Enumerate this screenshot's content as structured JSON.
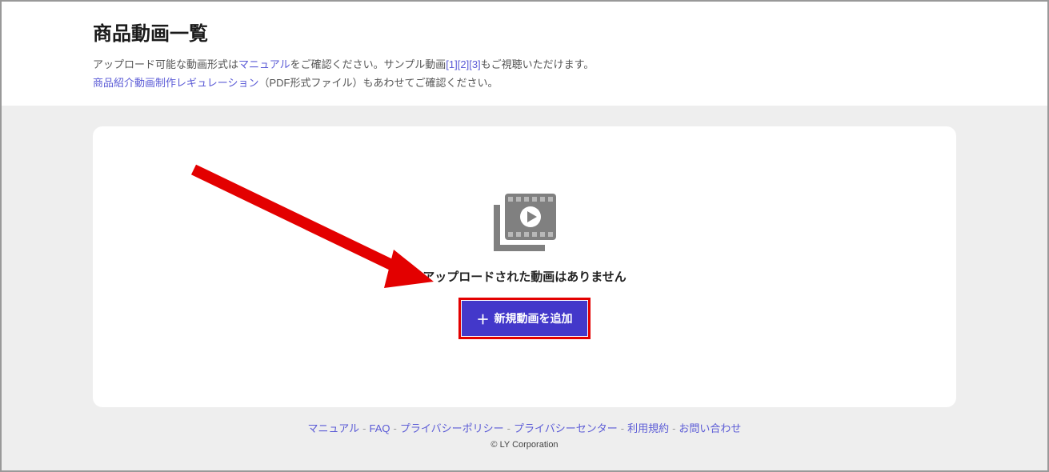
{
  "header": {
    "title": "商品動画一覧",
    "desc_line1_pre": "アップロード可能な動画形式は",
    "desc_line1_manual": "マニュアル",
    "desc_line1_mid": "をご確認ください。サンプル動画",
    "sample1": "[1]",
    "sample2": "[2]",
    "sample3": "[3]",
    "desc_line1_post": "もご視聴いただけます。",
    "desc_line2_link": "商品紹介動画制作レギュレーション",
    "desc_line2_post": "（PDF形式ファイル）もあわせてご確認ください。"
  },
  "empty": {
    "message": "アップロードされた動画はありません",
    "button_label": "新規動画を追加"
  },
  "footer": {
    "links": {
      "manual": "マニュアル",
      "faq": "FAQ",
      "privacy_policy": "プライバシーポリシー",
      "privacy_center": "プライバシーセンター",
      "terms": "利用規約",
      "contact": "お問い合わせ"
    },
    "copyright": "© LY Corporation"
  }
}
